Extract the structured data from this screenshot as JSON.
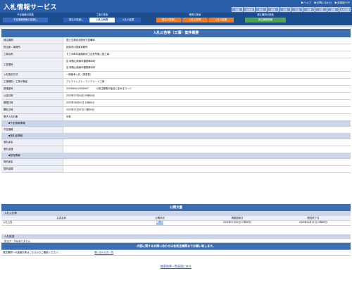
{
  "header": {
    "logo": "入札情報サービス",
    "links": [
      "▶ヘルプ",
      "▶お問い合わせ",
      "▶全国版TOP"
    ],
    "regions": [
      "全国",
      "北海道",
      "東北",
      "関東",
      "北陸",
      "中部",
      "近畿",
      "中国",
      "四国",
      "九州沖縄"
    ]
  },
  "nav": {
    "groups": [
      {
        "title": "予定価格の検索",
        "buttons": [
          "予定価格情報の見通し"
        ],
        "color": "#3a6bc6"
      },
      {
        "title": "工事の検索",
        "buttons": [
          "発注の見通し",
          "入札公告等",
          "入札の結果"
        ],
        "color": "#2d62b8"
      },
      {
        "title": "業務の検索",
        "buttons": [
          "発注の見通し",
          "入札公告等",
          "入札の結果"
        ],
        "color": "#f07a1f"
      },
      {
        "title": "発注機関の検索",
        "buttons": [
          "発注機関情報"
        ],
        "color": "#4fa54a"
      }
    ]
  },
  "detail": {
    "title": "入札公告等（工事）案件概要",
    "rows": [
      {
        "label": "発注機関",
        "value": "国土交通省北陸地方整備局"
      },
      {
        "label": "担当部・事務所",
        "value": "紀南河川国道事務所"
      },
      {
        "label": "工事名称",
        "value": "すさみ串本道路和深ゴ出来所機上部工事"
      },
      {
        "label": "工事場所",
        "value": "自 和歌山県東牟婁郡串本町",
        "value2": "至 和歌山県東牟婁郡串本町"
      },
      {
        "label": "入札契約方式",
        "value": "一般競争入札（简易型）"
      },
      {
        "label": "工事種別／工事の等級",
        "value": "プレストレスト・コンクリート工事"
      },
      {
        "label": "調達番号",
        "value": "20230606123030007　　　※発注機関が独自に定めるコード"
      },
      {
        "label": "公告日時",
        "value": "2023年07月04日 00時00分"
      },
      {
        "label": "期限日時",
        "value": "2023年08月01日 12時00分"
      },
      {
        "label": "開札日時",
        "value": "2023年11月07日 13時00分"
      },
      {
        "label": "電子入札対象",
        "value": "対象"
      }
    ],
    "sections": [
      {
        "title": "■予定価格情報",
        "rows": [
          {
            "label": "予定価格",
            "value": ""
          }
        ]
      },
      {
        "title": "■落札者情報",
        "rows": [
          {
            "label": "落札者名",
            "value": ""
          },
          {
            "label": "落札金額",
            "value": ""
          }
        ]
      },
      {
        "title": "■契約情報",
        "rows": [
          {
            "label": "契約者名",
            "value": ""
          },
          {
            "label": "契約金額",
            "value": ""
          }
        ]
      }
    ]
  },
  "docs": {
    "title": "公開文書",
    "subtitle": "入札公告等",
    "headers": [
      "文書名称",
      "公開状況",
      "掲載更新日",
      "閲覧終了日"
    ],
    "rows": [
      [
        "入札公告",
        "公開中",
        "2023年07月04日 07時59分",
        "2023年11月21日 23時59分"
      ]
    ]
  },
  "result": {
    "title": "入札経過",
    "text": "該当データはありません"
  },
  "contact": {
    "title": "内容に関するお問い合わせは各発注機関までお願い致します。",
    "text": "発注機関への連絡先等はこちらからご確認ください。",
    "link": "問い合わせ先一覧"
  },
  "footer": {
    "link": "検索結果一覧画面に戻る"
  }
}
